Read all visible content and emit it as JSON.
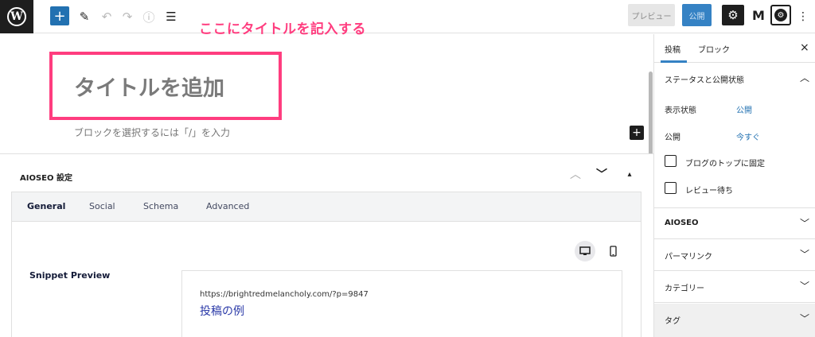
{
  "toolbar": {
    "wp_logo": "W",
    "add_icon": "+",
    "edit_icon": "✎",
    "undo_icon": "↶",
    "redo_icon": "↷",
    "info_icon": "ⓘ",
    "list_icon": "☰",
    "preview_label": "プレビュー",
    "publish_label": "公開",
    "settings_icon": "⚙",
    "jetpack_icon": "M",
    "aioseo_icon": "⚙",
    "more_icon": "⋮"
  },
  "annotation": "ここにタイトルを記入する",
  "editor": {
    "title_placeholder": "タイトルを追加",
    "block_hint": "ブロックを選択するには「/」を入力",
    "block_add_icon": "+"
  },
  "aioseo": {
    "title": "AIOSEO 設定",
    "ctrl_up": "︿",
    "ctrl_down": "﹀",
    "ctrl_top": "▴",
    "tabs": [
      {
        "label": "General"
      },
      {
        "label": "Social"
      },
      {
        "label": "Schema"
      },
      {
        "label": "Advanced"
      }
    ],
    "snippet_label": "Snippet Preview",
    "snippet_url": "https://brightredmelancholy.com/?p=9847",
    "snippet_title": "投稿の例"
  },
  "sidebar": {
    "tab_post": "投稿",
    "tab_block": "ブロック",
    "close_icon": "×",
    "status_section": "ステータスと公開状態",
    "visibility_label": "表示状態",
    "visibility_value": "公開",
    "publish_label": "公開",
    "publish_value": "今すぐ",
    "sticky_label": "ブログのトップに固定",
    "pending_label": "レビュー待ち",
    "sections": [
      {
        "label": "AIOSEO"
      },
      {
        "label": "パーマリンク"
      },
      {
        "label": "カテゴリー"
      },
      {
        "label": "タグ"
      }
    ],
    "chevron_up": "︿",
    "chevron_down": "﹀"
  },
  "colors": {
    "annotation": "#ff3d7f",
    "accent": "#3582c4",
    "link": "#2271b1"
  }
}
